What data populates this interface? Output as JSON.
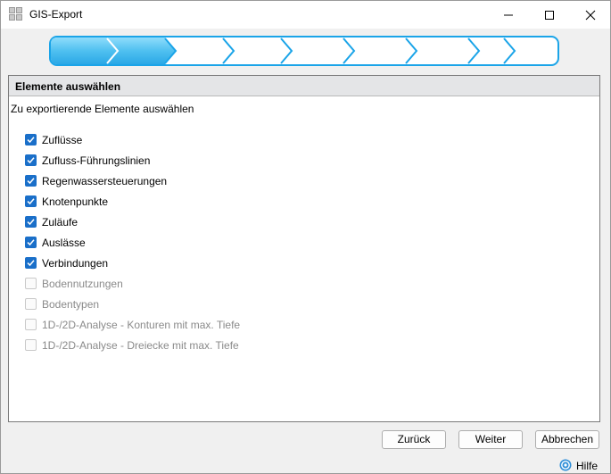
{
  "window": {
    "title": "GIS-Export"
  },
  "wizard": {
    "total_steps": 9,
    "current_step": 2
  },
  "panel": {
    "header": "Elemente auswählen",
    "subtitle": "Zu exportierende Elemente auswählen",
    "items": [
      {
        "label": "Zuflüsse",
        "checked": true,
        "enabled": true
      },
      {
        "label": "Zufluss-Führungslinien",
        "checked": true,
        "enabled": true
      },
      {
        "label": "Regenwassersteuerungen",
        "checked": true,
        "enabled": true
      },
      {
        "label": "Knotenpunkte",
        "checked": true,
        "enabled": true
      },
      {
        "label": "Zuläufe",
        "checked": true,
        "enabled": true
      },
      {
        "label": "Auslässe",
        "checked": true,
        "enabled": true
      },
      {
        "label": "Verbindungen",
        "checked": true,
        "enabled": true
      },
      {
        "label": "Bodennutzungen",
        "checked": false,
        "enabled": false
      },
      {
        "label": "Bodentypen",
        "checked": false,
        "enabled": false
      },
      {
        "label": "1D-/2D-Analyse - Konturen mit max. Tiefe",
        "checked": false,
        "enabled": false
      },
      {
        "label": "1D-/2D-Analyse - Dreiecke mit max. Tiefe",
        "checked": false,
        "enabled": false
      }
    ]
  },
  "buttons": {
    "back": "Zurück",
    "next": "Weiter",
    "cancel": "Abbrechen"
  },
  "help": {
    "label": "Hilfe"
  },
  "colors": {
    "accent": "#1a6fc9",
    "wizard_border": "#1aa4e8",
    "wizard_active": "#4fc0f0"
  }
}
